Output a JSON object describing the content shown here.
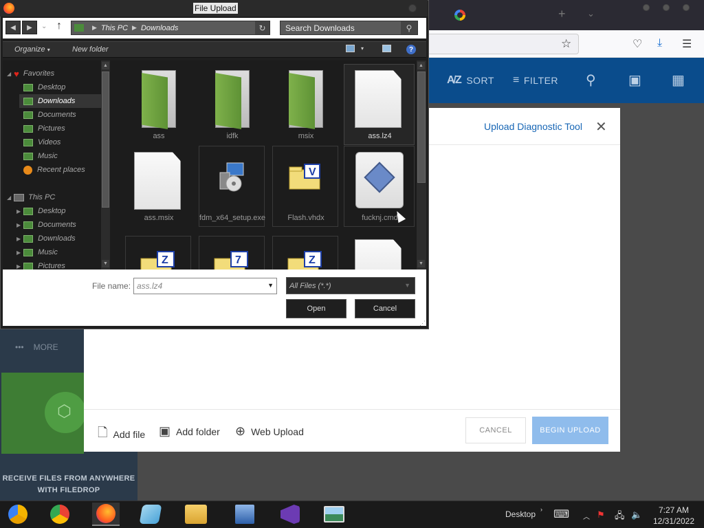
{
  "dialog": {
    "title": "File Upload",
    "address": {
      "crumb1": "This PC",
      "crumb2": "Downloads"
    },
    "search_placeholder": "Search Downloads",
    "commands": {
      "organize": "Organize",
      "new_folder": "New folder"
    },
    "nav": {
      "favorites": "Favorites",
      "fav_items": [
        "Desktop",
        "Downloads",
        "Documents",
        "Pictures",
        "Videos",
        "Music",
        "Recent places"
      ],
      "this_pc": "This PC",
      "pc_items": [
        "Desktop",
        "Documents",
        "Downloads",
        "Music",
        "Pictures"
      ]
    },
    "files": [
      {
        "name": "ass",
        "kind": "folder"
      },
      {
        "name": "idfk",
        "kind": "folder"
      },
      {
        "name": "msix",
        "kind": "folder"
      },
      {
        "name": "ass.lz4",
        "kind": "document"
      },
      {
        "name": "ass.msix",
        "kind": "document"
      },
      {
        "name": "fdm_x64_setup.exe",
        "kind": "setup"
      },
      {
        "name": "Flash.vhdx",
        "kind": "vhd"
      },
      {
        "name": "fucknj.cmd",
        "kind": "cmd"
      },
      {
        "name": "",
        "kind": "archive-z"
      },
      {
        "name": "",
        "kind": "archive-7"
      },
      {
        "name": "",
        "kind": "archive-z"
      },
      {
        "name": "",
        "kind": "text"
      }
    ],
    "file_name_label": "File name:",
    "file_name_value": "ass.lz4",
    "filter_value": "All Files (*.*)",
    "open_label": "Open",
    "cancel_label": "Cancel"
  },
  "app": {
    "toolbar": {
      "sort": "SORT",
      "filter": "FILTER"
    },
    "diagnostic_link": "Upload Diagnostic Tool",
    "footer": {
      "add_file": "Add file",
      "add_folder": "Add folder",
      "web_upload": "Web Upload",
      "cancel": "CANCEL",
      "begin_upload": "BEGIN UPLOAD"
    },
    "sidebar": {
      "more": "MORE",
      "promo_line1": "RECEIVE FILES FROM ANYWHERE",
      "promo_line2": "WITH FILEDROP"
    }
  },
  "taskbar": {
    "desktop_label": "Desktop",
    "time": "7:27 AM",
    "date": "12/31/2022",
    "apps": [
      "chrome-canary",
      "chrome",
      "firefox",
      "notepad",
      "file-explorer",
      "remote-desktop",
      "visual-studio",
      "photos"
    ]
  }
}
